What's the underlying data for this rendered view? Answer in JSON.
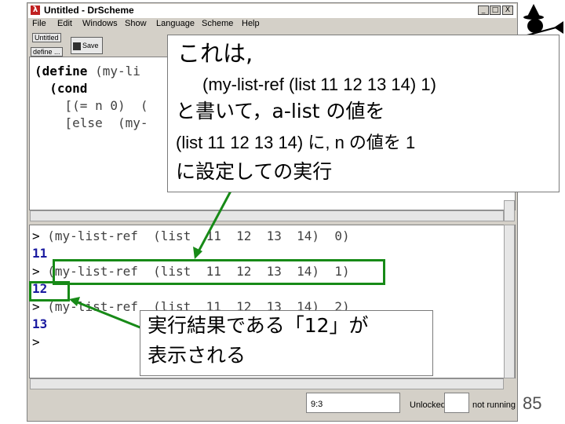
{
  "window": {
    "title": "Untitled - DrScheme",
    "controls": [
      "_",
      "□",
      "X"
    ]
  },
  "menu": [
    "File",
    "Edit",
    "Windows",
    "Show",
    "Language",
    "Scheme",
    "Help"
  ],
  "toolbar": {
    "tab_label": "Untitled",
    "define_label": "define ...",
    "save_label": "Save"
  },
  "definitions": {
    "line1_kw": "(define",
    "line1_rest": " (my-li",
    "line2_kw": "  (cond",
    "line3": "    [(= n 0)  (",
    "line4": "    [else  (my-"
  },
  "interactions": [
    {
      "prompt": ">",
      "expr": " (my-list-ref  (list  11  12  13  14)  0)",
      "result": "11"
    },
    {
      "prompt": ">",
      "expr": " (my-list-ref  (list  11  12  13  14)  1)",
      "result": "12"
    },
    {
      "prompt": ">",
      "expr": " (my-list-ref  (list  11  12  13  14)  2)",
      "result": "13"
    },
    {
      "prompt": ">",
      "expr": "",
      "result": ""
    }
  ],
  "callout_top": {
    "line1": "これは,",
    "line2": "(my-list-ref (list 11 12 13 14) 1)",
    "line3": "と書いて，a-list の値を",
    "line4": "(list 11 12 13 14) に, n の値を 1",
    "line5": "に設定しての実行"
  },
  "callout_bottom": {
    "line1": "実行結果である「12」が",
    "line2": "表示される"
  },
  "status": {
    "position": "9:3",
    "lock": "Unlocked",
    "run": "not running"
  },
  "page_number": "85",
  "colors": {
    "highlight": "#178a17",
    "result_text": "#1a1aa0"
  },
  "icons": [
    "witch-on-broom-icon",
    "scheme-lambda-icon",
    "save-icon"
  ]
}
